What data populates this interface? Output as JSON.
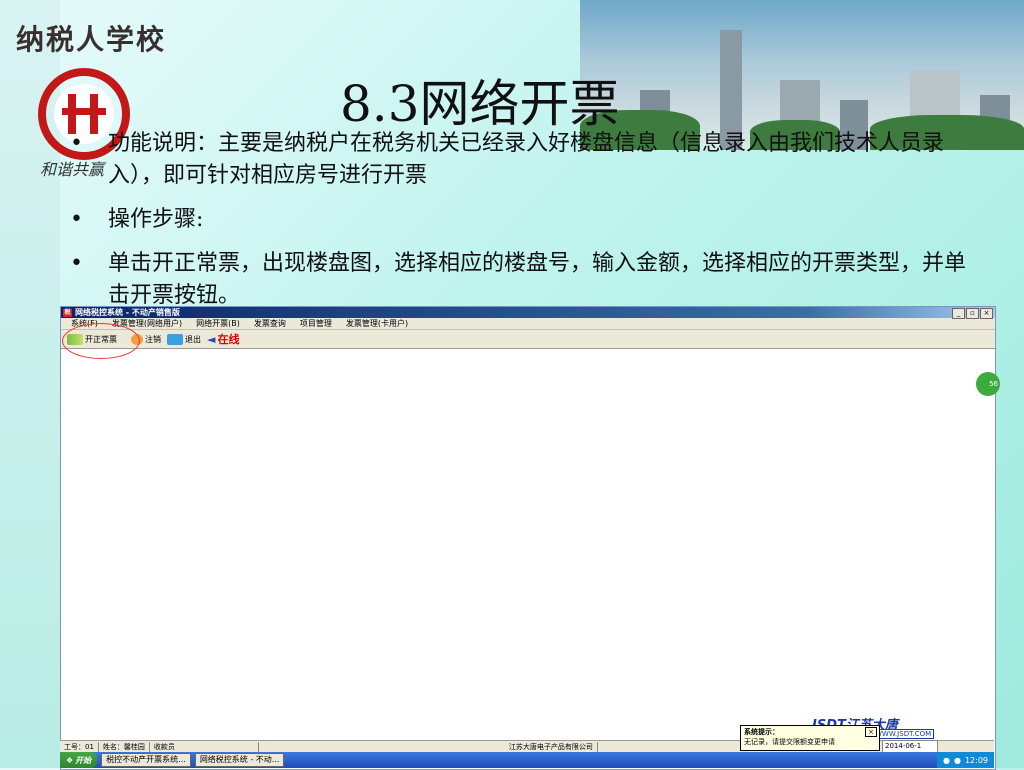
{
  "slide": {
    "school_title": "纳税人学校",
    "logo_sub": "和谐共赢",
    "title": "8.3网络开票",
    "bullets": [
      "功能说明：主要是纳税户在税务机关已经录入好楼盘信息（信息录入由我们技术人员录入），即可针对相应房号进行开票",
      "操作步骤:",
      "单击开正常票，出现楼盘图，选择相应的楼盘号，输入金额，选择相应的开票类型，并单击开票按钮。"
    ]
  },
  "window": {
    "title": "网络税控系统 - 不动产销售版",
    "controls": [
      "_",
      "▫",
      "×"
    ],
    "menu": [
      "系统(F)",
      "发票管理(网络用户)",
      "网络开票(B)",
      "发票查询",
      "项目管理",
      "发票管理(卡用户)"
    ],
    "toolbar": {
      "issue_normal": "开正常票",
      "cancel": "注销",
      "exit": "退出",
      "online": "在线"
    },
    "badge": "56",
    "brand": "JSDT江苏大唐",
    "brand_url": "WWW.JSDT.COM",
    "status": {
      "job_no": "工号：01",
      "name": "姓名：馨桂园",
      "role": "收款员",
      "company": "江苏大唐电子产品有限公司"
    },
    "popup": {
      "title": "系统提示：",
      "text": "无记录，请提交限额变更申请",
      "close": "×"
    },
    "date": "2014-06-1"
  },
  "taskbar": {
    "start": "开始",
    "tasks": [
      "税控不动产开票系统...",
      "网络税控系统 - 不动..."
    ],
    "clock": "12:09"
  },
  "colors": {
    "background": "#bff3ee",
    "title_bar": "#0a246a",
    "online": "#dd0000",
    "taskbar": "#1e4fb8"
  }
}
